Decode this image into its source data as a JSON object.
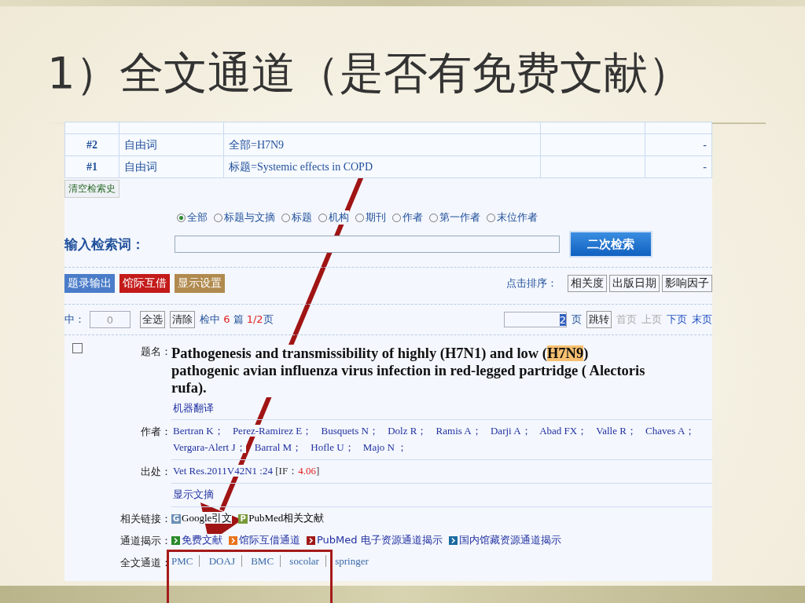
{
  "slide": {
    "title": "1）全文通道（是否有免费文献）"
  },
  "history": {
    "rows": [
      {
        "number": "#2",
        "field": "自由词",
        "query": "全部=H7N9",
        "column_5": "-"
      },
      {
        "number": "#1",
        "field": "自由词",
        "query": "标题=Systemic effects in COPD",
        "column_5": "-"
      }
    ],
    "clear_button": "清空检索史"
  },
  "search": {
    "scopes": [
      {
        "label": "全部",
        "selected": true
      },
      {
        "label": "标题与文摘",
        "selected": false
      },
      {
        "label": "标题",
        "selected": false
      },
      {
        "label": "机构",
        "selected": false
      },
      {
        "label": "期刊",
        "selected": false
      },
      {
        "label": "作者",
        "selected": false
      },
      {
        "label": "第一作者",
        "selected": false
      },
      {
        "label": "末位作者",
        "selected": false
      }
    ],
    "label": "输入检索词：",
    "button": "二次检索"
  },
  "toolbar": {
    "actions": [
      {
        "label": "题录输出",
        "color": "#4a7cc9"
      },
      {
        "label": "馆际互借",
        "color": "#c41a1a"
      },
      {
        "label": "显示设置",
        "color": "#b08a4e"
      }
    ],
    "sort_label": "点击排序：",
    "sort_buttons": [
      "相关度",
      "出版日期",
      "影响因子"
    ]
  },
  "pager": {
    "selected_label": "中：",
    "selected_count": "0",
    "buttons": [
      "全选",
      "清除"
    ],
    "summary": {
      "prefix": "检中",
      "count": "6",
      "unit": "篇",
      "pages": "1/2",
      "suffix": "页"
    },
    "page_value": "2",
    "page_unit": "页",
    "jump_button": "跳转",
    "links": [
      {
        "label": "首页",
        "disabled": true
      },
      {
        "label": "上页",
        "disabled": true
      },
      {
        "label": "下页",
        "disabled": false
      },
      {
        "label": "末页",
        "disabled": false
      }
    ]
  },
  "record": {
    "checked": false,
    "title_label": "题名：",
    "title_before": "Pathogenesis and transmissibility of highly (H7N1) and low (",
    "title_highlight": "H7N9",
    "title_after": ") pathogenic avian influenza virus infection in red-legged partridge ( Alectoris rufa).",
    "translate_link": "机器翻译",
    "authors_label": "作者：",
    "authors": [
      "Bertran K；",
      "Perez-Ramirez E；",
      "Busquets N；",
      "Dolz R；",
      "Ramis A；",
      "Darji A；",
      "Abad FX；",
      "Valle R；",
      "Chaves A；",
      "Vergara-Alert J；",
      "Barral M；",
      "Hofle U；",
      "Majo N ；"
    ],
    "source_label": "出处：",
    "source": "Vet Res.2011V42N1 :24",
    "if_label": "[IF：",
    "if_value": "4.06",
    "if_end": "]",
    "abstract_link": "显示文摘",
    "related_label": "相关链接：",
    "related_links": [
      {
        "badge": "G",
        "label": "Google引文",
        "color": "#6b8fb5"
      },
      {
        "badge": "P",
        "label": "PubMed相关文献",
        "color": "#7a9a3a"
      }
    ],
    "channels_label": "通道揭示：",
    "channels": [
      {
        "label": "免费文献",
        "color": "#2a8a2a"
      },
      {
        "label": "馆际互借通道",
        "color": "#e8731a"
      },
      {
        "label": "PubMed 电子资源通道揭示",
        "color": "#a01818"
      },
      {
        "label": "国内馆藏资源通道揭示",
        "color": "#1a6aa0"
      }
    ],
    "fulltext_label": "全文通道：",
    "fulltext_links": [
      "PMC",
      "DOAJ",
      "BMC",
      "socolar",
      "springer"
    ]
  }
}
